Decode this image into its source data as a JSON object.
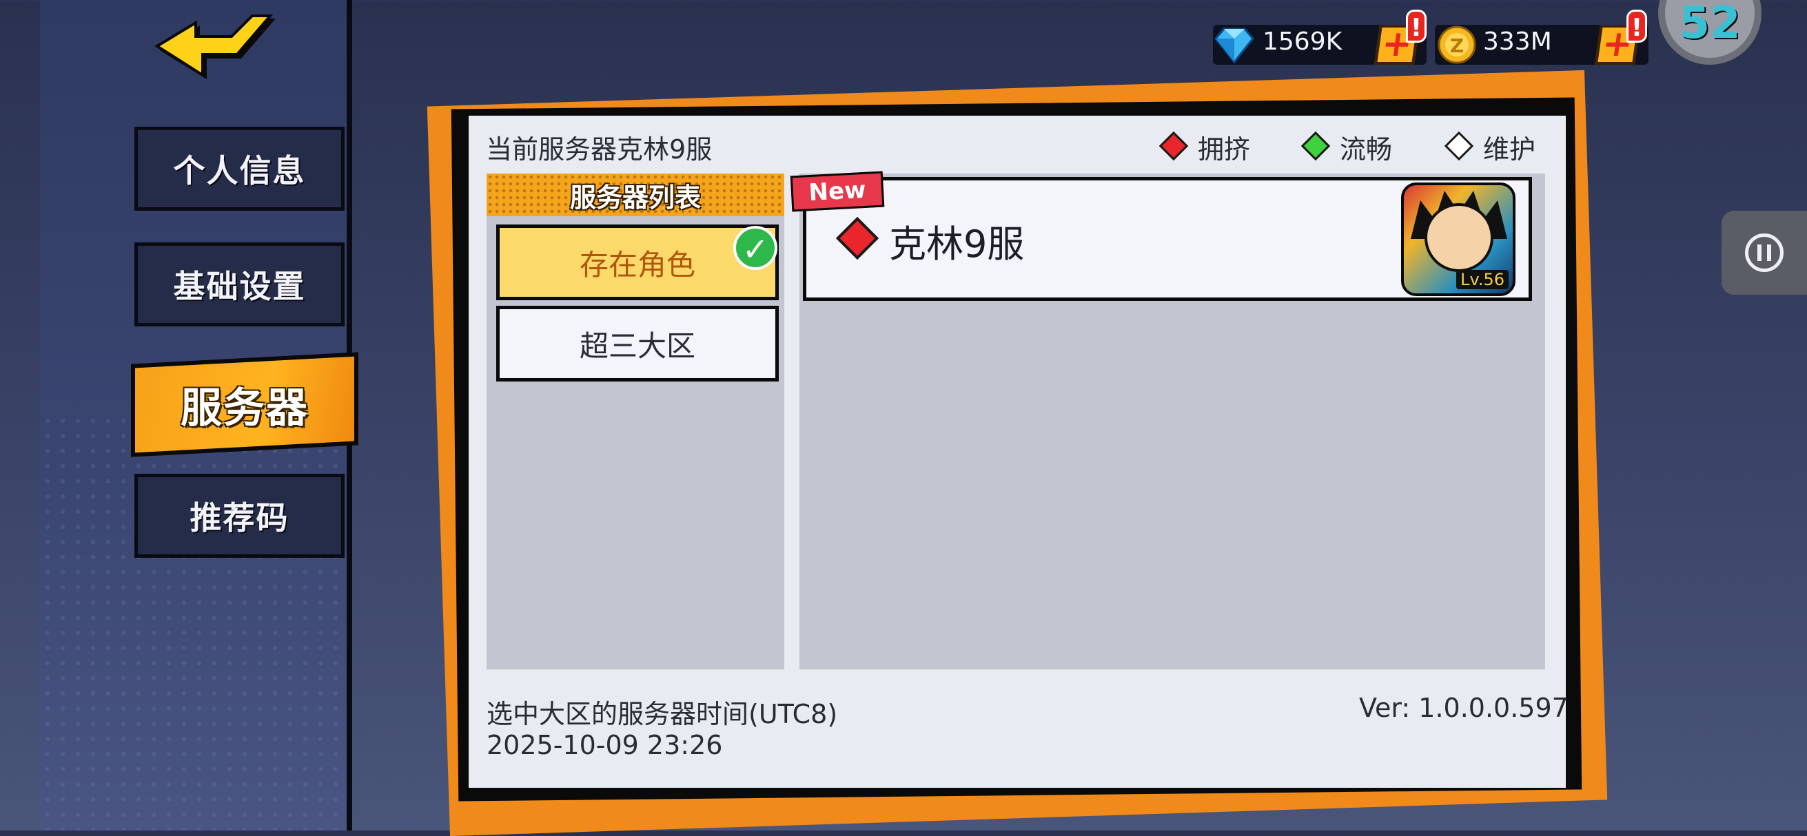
{
  "sidebar": {
    "items": [
      {
        "label": "个人信息",
        "active": false
      },
      {
        "label": "基础设置",
        "active": false
      },
      {
        "label": "服务器",
        "active": true
      },
      {
        "label": "推荐码",
        "active": false
      }
    ]
  },
  "resources": {
    "diamonds": "1569K",
    "coins": "333M",
    "alert_mark": "!"
  },
  "corner_badge": {
    "value": "52"
  },
  "panel": {
    "current_server": "当前服务器克林9服",
    "legend": [
      {
        "label": "拥挤",
        "color": "#e8262c"
      },
      {
        "label": "流畅",
        "color": "#3fd23f"
      },
      {
        "label": "维护",
        "color": "#ffffff"
      }
    ],
    "list_header": "服务器列表",
    "list_items": [
      {
        "label": "存在角色",
        "selected": true
      },
      {
        "label": "超三大区",
        "selected": false
      }
    ],
    "server_card": {
      "new_tag": "New",
      "name": "克林9服",
      "status_color": "#e8262c",
      "level": "Lv.56"
    },
    "time_label": "选中大区的服务器时间(UTC8)",
    "time_value": "2025-10-09 23:26",
    "version": "Ver: 1.0.0.0.597"
  },
  "colors": {
    "accent_orange": "#f5a51c",
    "selected_item": "#fbd96a",
    "selected_text": "#b0560d"
  }
}
